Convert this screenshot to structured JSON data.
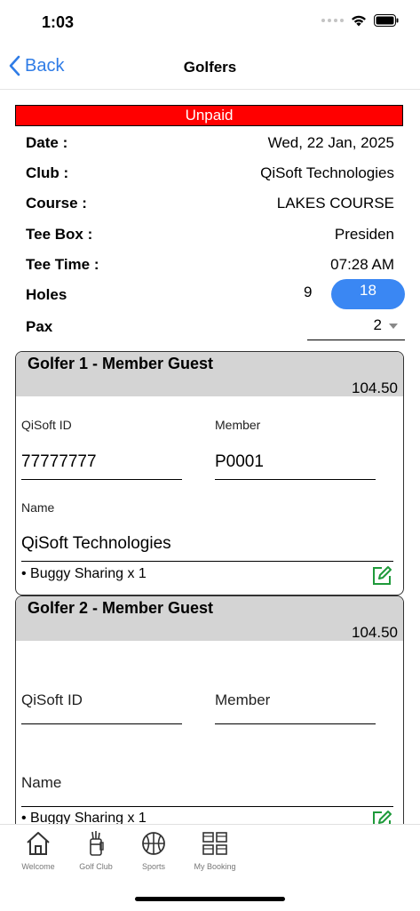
{
  "status_bar": {
    "time": "1:03"
  },
  "nav": {
    "back_label": "Back",
    "title": "Golfers"
  },
  "payment_status": "Unpaid",
  "booking_info": [
    {
      "label": "Date :",
      "value": "Wed, 22 Jan, 2025"
    },
    {
      "label": "Club :",
      "value": "QiSoft Technologies"
    },
    {
      "label": "Course :",
      "value": "LAKES COURSE"
    },
    {
      "label": "Tee Box :",
      "value": "Presiden"
    },
    {
      "label": "Tee Time :",
      "value": "07:28 AM"
    }
  ],
  "holes": {
    "label": "Holes",
    "options": [
      "9",
      "18"
    ],
    "selected": "18"
  },
  "pax": {
    "label": "Pax",
    "value": "2"
  },
  "golfers": [
    {
      "title": "Golfer 1 - Member Guest",
      "price": "104.50",
      "qisoft_id_label": "QiSoft ID",
      "qisoft_id": "77777777",
      "member_label": "Member",
      "member": "P0001",
      "name_label": "Name",
      "name": "QiSoft Technologies",
      "addon": "• Buggy Sharing x 1"
    },
    {
      "title": "Golfer 2 - Member Guest",
      "price": "104.50",
      "qisoft_id_label": "QiSoft ID",
      "qisoft_id": "",
      "member_label": "Member",
      "member": "",
      "name_label": "Name",
      "name": "",
      "addon": "• Buggy Sharing x 1"
    }
  ],
  "tabs": [
    {
      "label": "Welcome",
      "icon": "home-icon"
    },
    {
      "label": "Golf Club",
      "icon": "golf-bag-icon"
    },
    {
      "label": "Sports",
      "icon": "basketball-icon"
    },
    {
      "label": "My Booking",
      "icon": "grid-icon"
    }
  ],
  "colors": {
    "accent": "#3a87f3",
    "unpaid": "#ff0000",
    "edit_icon": "#1e9a3a",
    "header_bg": "#d4d4d4"
  }
}
